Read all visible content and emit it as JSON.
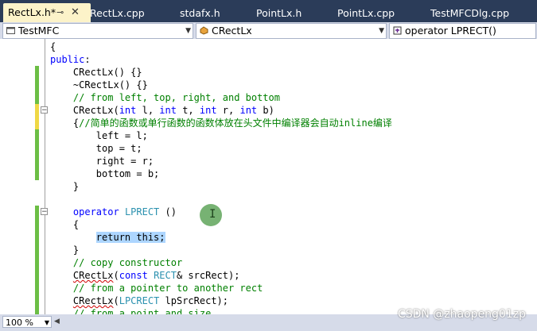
{
  "tabs": [
    {
      "label": "RectLx.h*",
      "active": true
    },
    {
      "label": "RectLx.cpp"
    },
    {
      "label": "stdafx.h"
    },
    {
      "label": "PointLx.h"
    },
    {
      "label": "PointLx.cpp"
    },
    {
      "label": "TestMFCDlg.cpp"
    }
  ],
  "nav": {
    "project": "TestMFC",
    "class": "CRectLx",
    "member": "operator LPRECT()"
  },
  "code_lines": [
    [
      [
        "tx",
        "{"
      ]
    ],
    [
      [
        "kw",
        "public"
      ],
      [
        "tx",
        ":"
      ]
    ],
    [
      [
        "tx",
        "    CRectLx() {}"
      ]
    ],
    [
      [
        "tx",
        "    ~CRectLx() {}"
      ]
    ],
    [
      [
        "cm",
        "    // from left, top, right, and bottom"
      ]
    ],
    [
      [
        "tx",
        "    CRectLx("
      ],
      [
        "kw",
        "int"
      ],
      [
        "tx",
        " l, "
      ],
      [
        "kw",
        "int"
      ],
      [
        "tx",
        " t, "
      ],
      [
        "kw",
        "int"
      ],
      [
        "tx",
        " r, "
      ],
      [
        "kw",
        "int"
      ],
      [
        "tx",
        " b)"
      ]
    ],
    [
      [
        "tx",
        "    {"
      ],
      [
        "cm",
        "//简单的函数或单行函数的函数体放在头文件中编译器会自动inline编译"
      ]
    ],
    [
      [
        "tx",
        "        left = l;"
      ]
    ],
    [
      [
        "tx",
        "        top = t;"
      ]
    ],
    [
      [
        "tx",
        "        right = r;"
      ]
    ],
    [
      [
        "tx",
        "        bottom = b;"
      ]
    ],
    [
      [
        "tx",
        "    }"
      ]
    ],
    [
      [
        "tx",
        ""
      ]
    ],
    [
      [
        "tx",
        "    "
      ],
      [
        "kw",
        "operator"
      ],
      [
        "tx",
        " "
      ],
      [
        "tp",
        "LPRECT"
      ],
      [
        "tx",
        " ()"
      ]
    ],
    [
      [
        "tx",
        "    {"
      ]
    ],
    [
      [
        "tx",
        "        "
      ],
      [
        "hl",
        "return this;"
      ]
    ],
    [
      [
        "tx",
        "    }"
      ]
    ],
    [
      [
        "cm",
        "    // copy constructor"
      ]
    ],
    [
      [
        "tx",
        "    "
      ],
      [
        "sq",
        "CRectLx"
      ],
      [
        "tx",
        "("
      ],
      [
        "kw",
        "const"
      ],
      [
        "tx",
        " "
      ],
      [
        "tp",
        "RECT"
      ],
      [
        "tx",
        "& srcRect);"
      ]
    ],
    [
      [
        "cm",
        "    // from a pointer to another rect"
      ]
    ],
    [
      [
        "tx",
        "    "
      ],
      [
        "sq",
        "CRectLx"
      ],
      [
        "tx",
        "("
      ],
      [
        "tp",
        "LPCRECT"
      ],
      [
        "tx",
        " lpSrcRect);"
      ]
    ],
    [
      [
        "cm",
        "    // from a point and size"
      ]
    ]
  ],
  "status": {
    "zoom": "100 %"
  },
  "watermark": "CSDN @zhaopeng01zp",
  "colors": {
    "keyword": "#0000ff",
    "comment": "#008000",
    "type": "#2b91af",
    "change_saved": "#6cbe45",
    "change_unsaved": "#efd845"
  }
}
